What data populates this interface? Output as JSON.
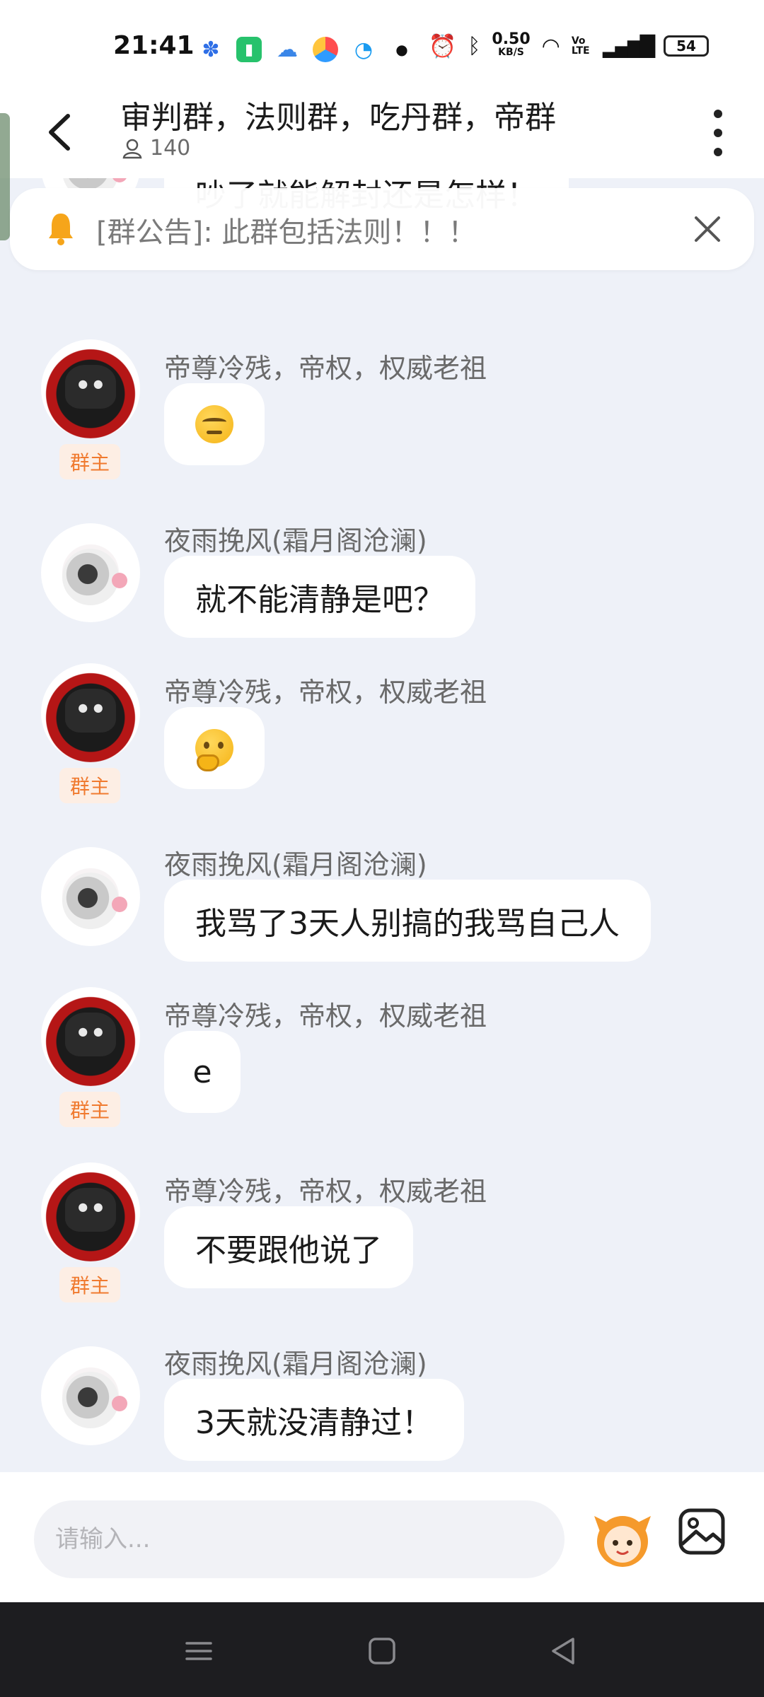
{
  "status_bar": {
    "time": "21:41",
    "network_speed": "0.50",
    "network_unit": "KB/S",
    "volte": "Vo LTE",
    "battery": "54"
  },
  "header": {
    "title": "审判群，法则群，吃丹群，帝群",
    "member_count": "140"
  },
  "notice": {
    "text": "[群公告]: 此群包括法则！！！"
  },
  "messages": [
    {
      "text": "吵了就能解封还是怎样！"
    },
    {
      "sender": "帝尊冷残，帝权，权威老祖",
      "badge": "群主",
      "emoji": "unamused-face"
    },
    {
      "sender": "夜雨挽风(霜月阁沧澜)",
      "text": "就不能清静是吧？"
    },
    {
      "sender": "帝尊冷残，帝权，权威老祖",
      "badge": "群主",
      "emoji": "thinking-face"
    },
    {
      "sender": "夜雨挽风(霜月阁沧澜)",
      "text": "我骂了3天人别搞的我骂自己人"
    },
    {
      "sender": "帝尊冷残，帝权，权威老祖",
      "badge": "群主",
      "text": "e"
    },
    {
      "sender": "帝尊冷残，帝权，权威老祖",
      "badge": "群主",
      "text": "不要跟他说了"
    },
    {
      "sender": "夜雨挽风(霜月阁沧澜)",
      "text": "3天就没清静过！"
    }
  ],
  "input": {
    "placeholder": "请输入..."
  },
  "colors": {
    "badge_text": "#f07a2f",
    "badge_bg": "#fdeee4",
    "chat_bg": "#eef1f8"
  }
}
